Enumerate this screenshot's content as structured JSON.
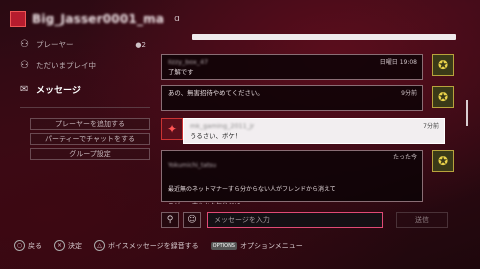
{
  "header": {
    "name": "Big_Jasser0001_ma",
    "badge": "ɑ"
  },
  "sidebar": {
    "items": [
      {
        "label": "プレーヤー",
        "count": "2",
        "icon": "people-icon"
      },
      {
        "label": "ただいまプレイ中",
        "icon": "gamepad-icon"
      },
      {
        "label": "メッセージ",
        "icon": "message-icon"
      }
    ],
    "buttons": [
      "プレーヤーを追加する",
      "パーティーでチャットをする",
      "グループ設定"
    ]
  },
  "messages": [
    {
      "sender": "lizzy_box_47",
      "time": "日曜日 19:08",
      "text": "了解です",
      "side": "right"
    },
    {
      "sender": "",
      "time": "9分前",
      "text": "あの、無害招待やめてください。",
      "side": "right"
    },
    {
      "sender": "mk_gaming_2011_jr",
      "time": "7分前",
      "text": "うるさい、ボケ！",
      "side": "left"
    },
    {
      "sender": "Yokumichi_tatsu",
      "time": "たった今",
      "text": "最近無のネットマナーすら分からない人がフレンドから消えて\n\nスゲーッ爽やかな気分だぜ\n新しいパンツをはいたばかりの正月元旦の朝のようによォ〜〜〜〜〜〜〜〜〜っ",
      "side": "right"
    }
  ],
  "input": {
    "placeholder": "メッセージを入力",
    "send_label": "送信"
  },
  "footer": [
    {
      "key": "○",
      "label": "戻る"
    },
    {
      "key": "×",
      "label": "決定"
    },
    {
      "key": "△",
      "label": "ボイスメッセージを録音する"
    },
    {
      "key": "OPTIONS",
      "label": "オプションメニュー"
    }
  ]
}
